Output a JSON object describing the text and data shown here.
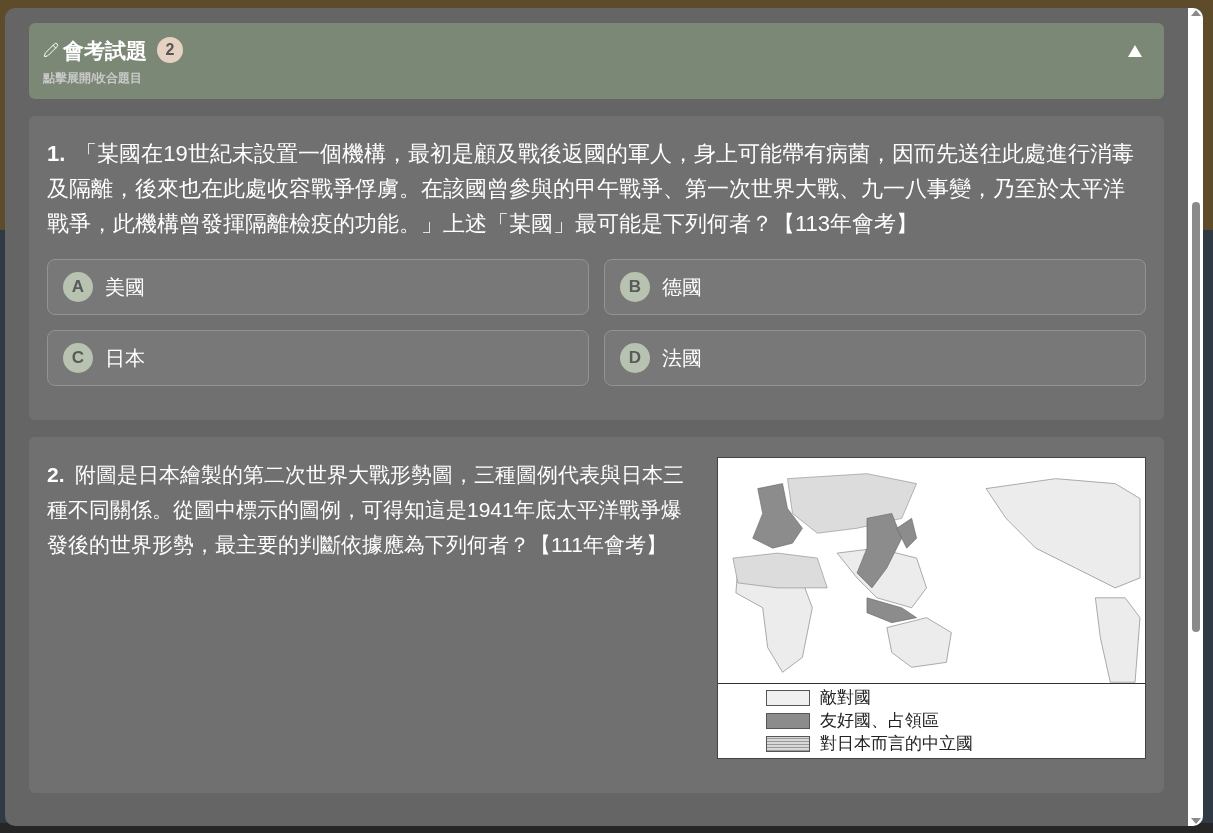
{
  "panel": {
    "title": "會考試題",
    "count": "2",
    "hint": "點擊展開/收合題目",
    "expanded": true
  },
  "questions": [
    {
      "number": "1.",
      "text": "「某國在19世紀末設置一個機構，最初是顧及戰後返國的軍人，身上可能帶有病菌，因而先送往此處進行消毒及隔離，後來也在此處收容戰爭俘虜。在該國曾參與的甲午戰爭、第一次世界大戰、九一八事變，乃至於太平洋戰爭，此機構曾發揮隔離檢疫的功能。」上述「某國」最可能是下列何者？【113年會考】",
      "options": [
        {
          "letter": "A",
          "text": "美國"
        },
        {
          "letter": "B",
          "text": "德國"
        },
        {
          "letter": "C",
          "text": "日本"
        },
        {
          "letter": "D",
          "text": "法國"
        }
      ]
    },
    {
      "number": "2.",
      "text": "附圖是日本繪製的第二次世界大戰形勢圖，三種圖例代表與日本三種不同關係。從圖中標示的圖例，可得知這是1941年底太平洋戰爭爆發後的世界形勢，最主要的判斷依據應為下列何者？【111年會考】",
      "figure": {
        "legend": [
          {
            "label": "敵對國",
            "color": "#f0f0f0",
            "kind": "plain"
          },
          {
            "label": "友好國、占領區",
            "color": "#8c8c8c",
            "kind": "plain"
          },
          {
            "label": "對日本而言的中立國",
            "color": "#d8d8d8",
            "kind": "striped"
          }
        ]
      }
    }
  ]
}
